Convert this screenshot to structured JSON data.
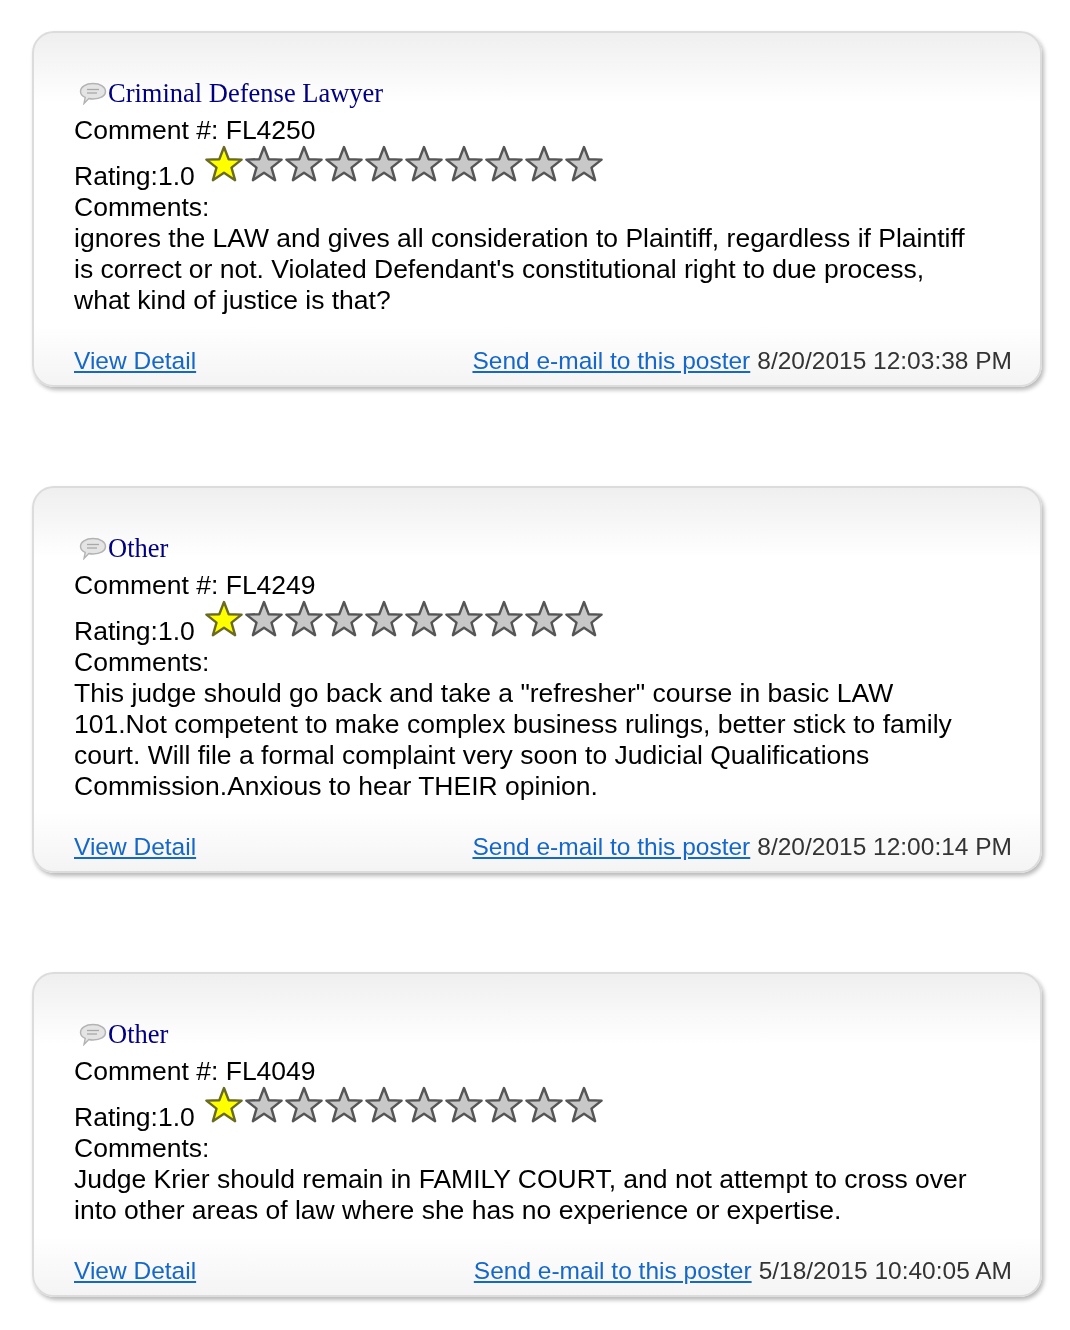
{
  "reviews": [
    {
      "category": "Criminal Defense Lawyer",
      "comment_number": "Comment #: FL4250",
      "rating_label": "Rating:1.0",
      "stars": 1,
      "comments_label": "Comments:",
      "comment": "ignores the LAW and gives all consideration to Plaintiff, regardless if Plaintiff is correct or not. Violated Defendant's constitutional right to due process, what kind of justice is that?",
      "detail_link": "View Detail",
      "email_link": "Send e-mail to this poster",
      "date": "8/20/2015 12:03:38 PM"
    },
    {
      "category": "Other",
      "comment_number": "Comment #: FL4249",
      "rating_label": "Rating:1.0",
      "stars": 1,
      "comments_label": "Comments:",
      "comment": "This judge should go back and take a \"refresher\" course in basic LAW 101.Not competent to make complex business rulings, better stick to family court. Will file a formal complaint very soon to Judicial Qualifications Commission.Anxious to hear THEIR opinion.",
      "detail_link": "View Detail",
      "email_link": "Send e-mail to this poster",
      "date": "8/20/2015 12:00:14 PM"
    },
    {
      "category": "Other",
      "comment_number": "Comment #: FL4049",
      "rating_label": "Rating:1.0",
      "stars": 1,
      "comments_label": "Comments:",
      "comment": "Judge Krier should remain in FAMILY COURT, and not attempt to cross over into other areas of law where she has no experience or expertise.",
      "detail_link": "View Detail",
      "email_link": "Send e-mail to this poster",
      "date": "5/18/2015 10:40:05 AM"
    }
  ]
}
